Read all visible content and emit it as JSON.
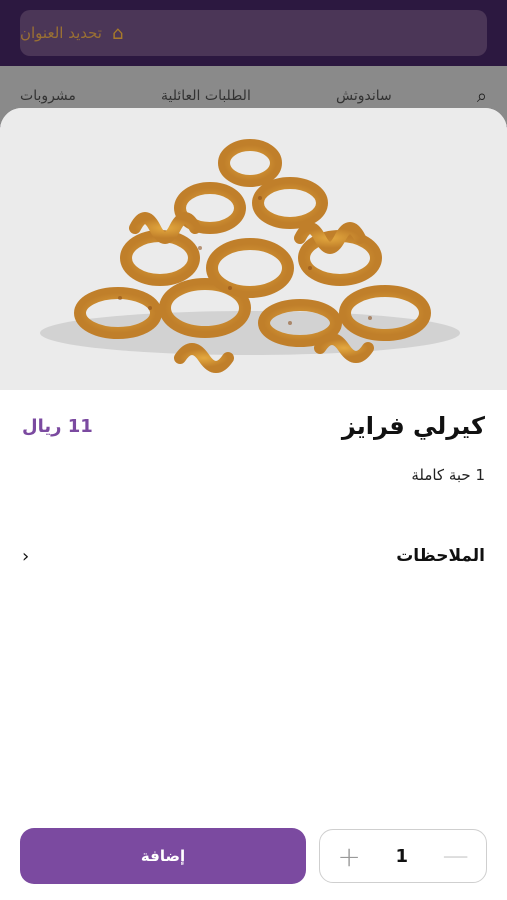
{
  "header": {
    "address": "تحديد العنوان",
    "pin_icon": "location-pin-icon"
  },
  "nav": {
    "items": [
      "ساندوتش",
      "الطلبات العائلية",
      "مشروبات"
    ],
    "search_icon": "search-icon"
  },
  "product": {
    "name": "كيرلي فرايز",
    "price": "11 ريال",
    "description": "1 حبة كاملة",
    "image_icon": "curly-fries-image"
  },
  "notes": {
    "label": "الملاحظات",
    "chevron_icon": "chevron-right-icon"
  },
  "actions": {
    "add_label": "إضافة",
    "quantity": "1",
    "plus": "+",
    "minus": "—"
  },
  "colors": {
    "accent": "#7b4aa0",
    "header_bg": "#2c1840"
  }
}
